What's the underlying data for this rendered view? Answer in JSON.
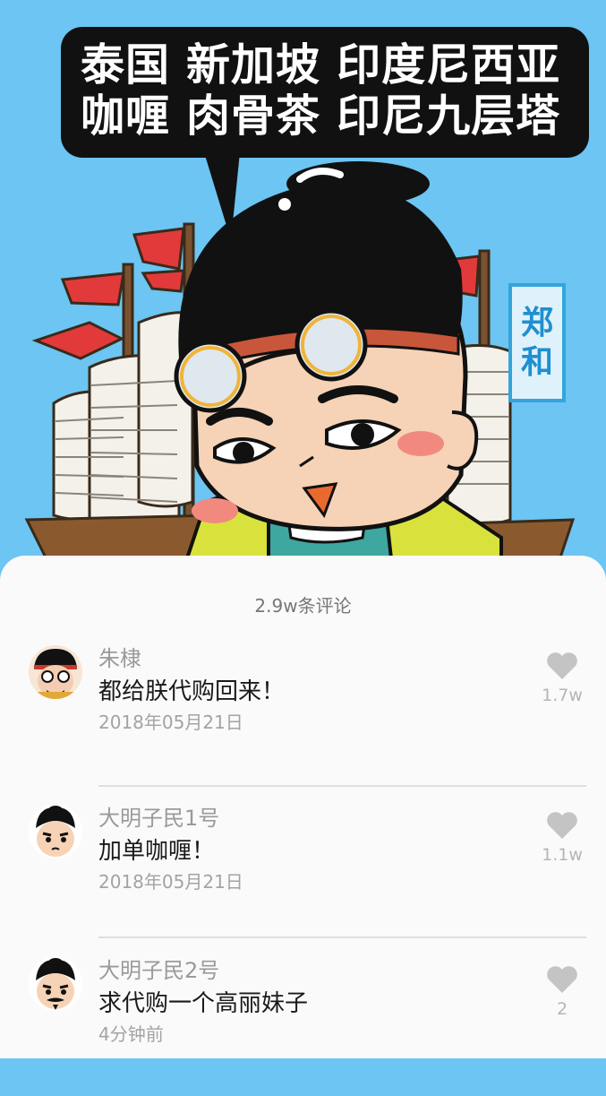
{
  "hero": {
    "speech_line1": "泰国 新加坡 印度尼西亚",
    "speech_line2": "咖喱 肉骨茶 印尼九层塔",
    "name_tag_char1": "郑",
    "name_tag_char2": "和"
  },
  "comments_header": "2.9w条评论",
  "comments": [
    {
      "username": "朱棣",
      "text": "都给朕代购回来！",
      "date": "2018年05月21日",
      "likes": "1.7w",
      "avatar_icon": "emperor-avatar-icon"
    },
    {
      "username": "大明子民1号",
      "text": "加单咖喱！",
      "date": "2018年05月21日",
      "likes": "1.1w",
      "avatar_icon": "citizen-avatar-icon"
    },
    {
      "username": "大明子民2号",
      "text": "求代购一个高丽妹子",
      "date": "4分钟前",
      "likes": "2",
      "avatar_icon": "bearded-citizen-avatar-icon"
    }
  ],
  "colors": {
    "sky": "#6cc5f2",
    "sheet": "#fafafa",
    "heart": "#c4c4c4",
    "speech_bg": "#111111"
  }
}
